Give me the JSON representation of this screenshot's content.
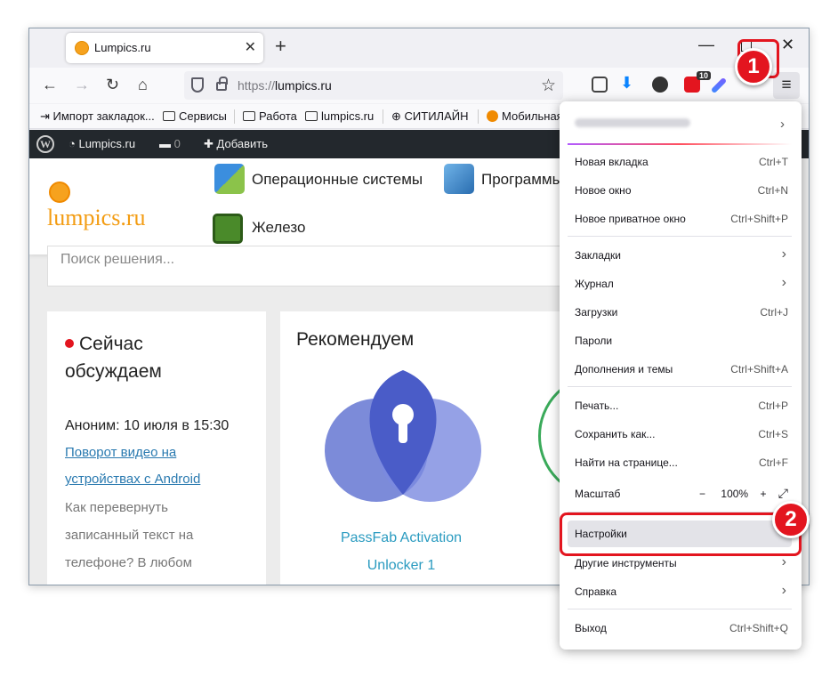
{
  "tab": {
    "title": "Lumpics.ru",
    "close": "✕"
  },
  "newtab": "+",
  "window_controls": {
    "minimize": "—",
    "close": "✕"
  },
  "nav": {
    "back": "←",
    "forward": "→",
    "reload": "↻",
    "home": "⌂"
  },
  "url": {
    "scheme": "https://",
    "host": "lumpics.ru",
    "star": "☆"
  },
  "toolbar": {
    "ext_badge": "10",
    "menu": "≡"
  },
  "bookmarks": [
    {
      "label": "Импорт закладок..."
    },
    {
      "label": "Сервисы"
    },
    {
      "label": "Работа"
    },
    {
      "label": "lumpics.ru"
    },
    {
      "label": "СИТИЛАЙН"
    },
    {
      "label": "Мобильная"
    }
  ],
  "wpbar": {
    "logo": "W",
    "site": "Lumpics.ru",
    "comments_count": "0",
    "add": "Добавить"
  },
  "site": {
    "logo_text": "lumpics.ru",
    "categories": [
      "Операционные системы",
      "Программы",
      "Железо"
    ],
    "search_placeholder": "Поиск решения...",
    "discuss": {
      "title_line1": "Сейчас",
      "title_line2": "обсуждаем",
      "meta": "Аноним: 10 июля в 15:30",
      "link_line1": "Поворот видео на",
      "link_line2": "устройствах с Android",
      "excerpt": [
        "Как перевернуть",
        "записанный текст на",
        "телефоне? В любом",
        "…"
      ]
    },
    "recommend": {
      "title": "Рекомендуем",
      "item_line1": "PassFab Activation",
      "item_line2": "Unlocker 1"
    }
  },
  "menu": {
    "account_chevron": "›",
    "items": [
      {
        "label": "Новая вкладка",
        "shortcut": "Ctrl+T"
      },
      {
        "label": "Новое окно",
        "shortcut": "Ctrl+N"
      },
      {
        "label": "Новое приватное окно",
        "shortcut": "Ctrl+Shift+P"
      },
      {
        "label": "Закладки",
        "shortcut": "›"
      },
      {
        "label": "Журнал",
        "shortcut": "›"
      },
      {
        "label": "Загрузки",
        "shortcut": "Ctrl+J"
      },
      {
        "label": "Пароли",
        "shortcut": ""
      },
      {
        "label": "Дополнения и темы",
        "shortcut": "Ctrl+Shift+A"
      },
      {
        "label": "Печать...",
        "shortcut": "Ctrl+P"
      },
      {
        "label": "Сохранить как...",
        "shortcut": "Ctrl+S"
      },
      {
        "label": "Найти на странице...",
        "shortcut": "Ctrl+F"
      },
      {
        "label": "Масштаб",
        "shortcut": ""
      },
      {
        "label": "Настройки",
        "shortcut": ""
      },
      {
        "label": "Другие инструменты",
        "shortcut": "›"
      },
      {
        "label": "Справка",
        "shortcut": "›"
      },
      {
        "label": "Выход",
        "shortcut": "Ctrl+Shift+Q"
      }
    ],
    "zoom": {
      "minus": "−",
      "value": "100%",
      "plus": "+",
      "fullscreen": "⤢"
    }
  },
  "steps": [
    "1",
    "2"
  ],
  "colors": {
    "highlight": "#e3151f",
    "link": "#2a7ab0",
    "logo": "#f39c12"
  }
}
